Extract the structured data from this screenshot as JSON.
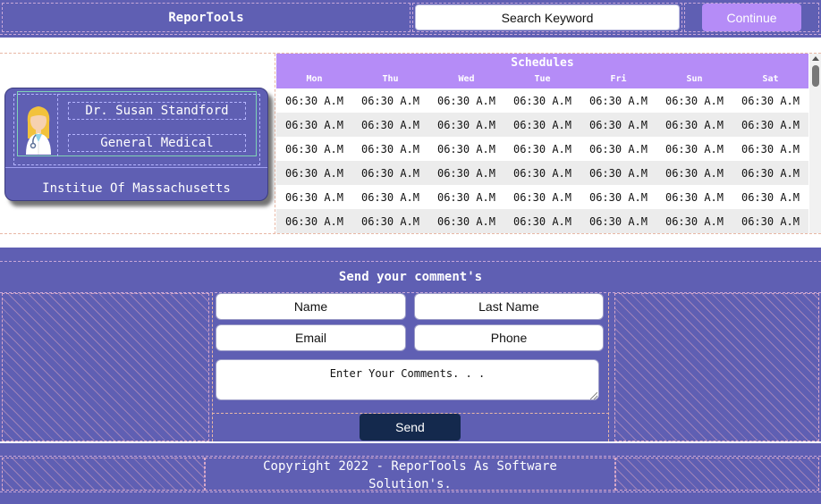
{
  "header": {
    "brand": "ReporTools",
    "search_placeholder": "Search Keyword",
    "continue_label": "Continue"
  },
  "doctor_card": {
    "name": "Dr. Susan Standford",
    "department": "General Medical",
    "institution": "Institue Of Massachusetts",
    "avatar_icon": "female-doctor-avatar-icon"
  },
  "schedule": {
    "title": "Schedules",
    "days": [
      "Mon",
      "Thu",
      "Wed",
      "Tue",
      "Fri",
      "Sun",
      "Sat"
    ],
    "rows": [
      [
        "06:30 A.M",
        "06:30 A.M",
        "06:30 A.M",
        "06:30 A.M",
        "06:30 A.M",
        "06:30 A.M",
        "06:30 A.M"
      ],
      [
        "06:30 A.M",
        "06:30 A.M",
        "06:30 A.M",
        "06:30 A.M",
        "06:30 A.M",
        "06:30 A.M",
        "06:30 A.M"
      ],
      [
        "06:30 A.M",
        "06:30 A.M",
        "06:30 A.M",
        "06:30 A.M",
        "06:30 A.M",
        "06:30 A.M",
        "06:30 A.M"
      ],
      [
        "06:30 A.M",
        "06:30 A.M",
        "06:30 A.M",
        "06:30 A.M",
        "06:30 A.M",
        "06:30 A.M",
        "06:30 A.M"
      ],
      [
        "06:30 A.M",
        "06:30 A.M",
        "06:30 A.M",
        "06:30 A.M",
        "06:30 A.M",
        "06:30 A.M",
        "06:30 A.M"
      ],
      [
        "06:30 A.M",
        "06:30 A.M",
        "06:30 A.M",
        "06:30 A.M",
        "06:30 A.M",
        "06:30 A.M",
        "06:30 A.M"
      ]
    ]
  },
  "comments": {
    "title": "Send your comment's",
    "name_placeholder": "Name",
    "last_name_placeholder": "Last Name",
    "email_placeholder": "Email",
    "phone_placeholder": "Phone",
    "comment_placeholder": "Enter Your Comments. . .",
    "send_label": "Send"
  },
  "footer": {
    "copyright_line1": "Copyright 2022 - ReporTools As Software",
    "copyright_line2": "Solution's."
  },
  "colors": {
    "primary": "#5f5fb3",
    "accent": "#b58cf7",
    "send_button": "#14294d",
    "row_alt": "#ececec"
  }
}
